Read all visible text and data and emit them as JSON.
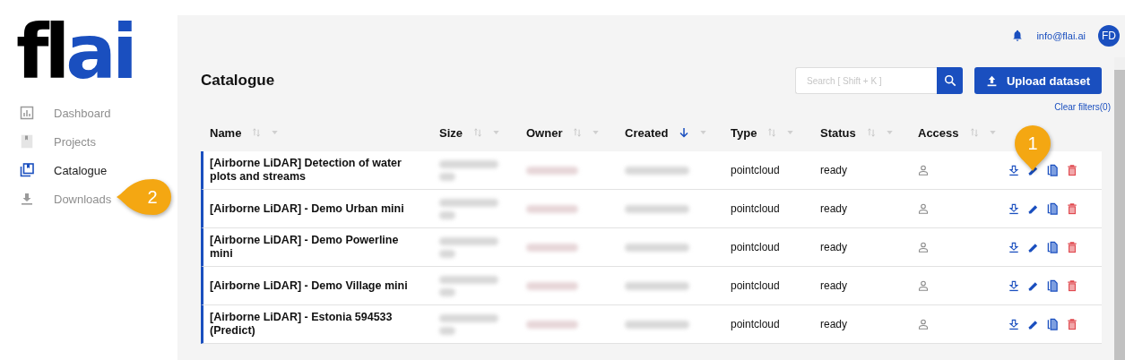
{
  "logo": [
    {
      "text": "fl",
      "color": "#000000"
    },
    {
      "text": "ai",
      "color": "#1a4fbf"
    }
  ],
  "sidebar": {
    "items": [
      {
        "label": "Dashboard",
        "kind": "chart",
        "selected": false
      },
      {
        "label": "Projects",
        "kind": "book",
        "selected": false
      },
      {
        "label": "Catalogue",
        "kind": "library",
        "selected": true
      },
      {
        "label": "Downloads",
        "kind": "download",
        "selected": false
      }
    ]
  },
  "header": {
    "email": "info@flai.ai",
    "avatar": "FD"
  },
  "page_title": "Catalogue",
  "search": {
    "placeholder": "Search [ Shift + K ]"
  },
  "upload_button": "Upload dataset",
  "clear_filters": "Clear filters(0)",
  "table": {
    "columns": [
      {
        "label": "Name",
        "sorted": false
      },
      {
        "label": "Size",
        "sorted": false
      },
      {
        "label": "Owner",
        "sorted": false
      },
      {
        "label": "Created",
        "sorted": true
      },
      {
        "label": "Type",
        "sorted": false
      },
      {
        "label": "Status",
        "sorted": false
      },
      {
        "label": "Access",
        "sorted": false
      }
    ],
    "rows": [
      {
        "name": "[Airborne LiDAR] Detection of water plots and streams",
        "type": "pointcloud",
        "status": "ready"
      },
      {
        "name": "[Airborne LiDAR] - Demo Urban mini",
        "type": "pointcloud",
        "status": "ready"
      },
      {
        "name": "[Airborne LiDAR] - Demo Powerline mini",
        "type": "pointcloud",
        "status": "ready"
      },
      {
        "name": "[Airborne LiDAR] - Demo Village mini",
        "type": "pointcloud",
        "status": "ready"
      },
      {
        "name": "[Airborne LiDAR] - Estonia 594533 (Predict)",
        "type": "pointcloud",
        "status": "ready"
      }
    ]
  },
  "callouts": [
    {
      "text": "1",
      "kind": "down"
    },
    {
      "text": "2",
      "kind": "left"
    }
  ]
}
